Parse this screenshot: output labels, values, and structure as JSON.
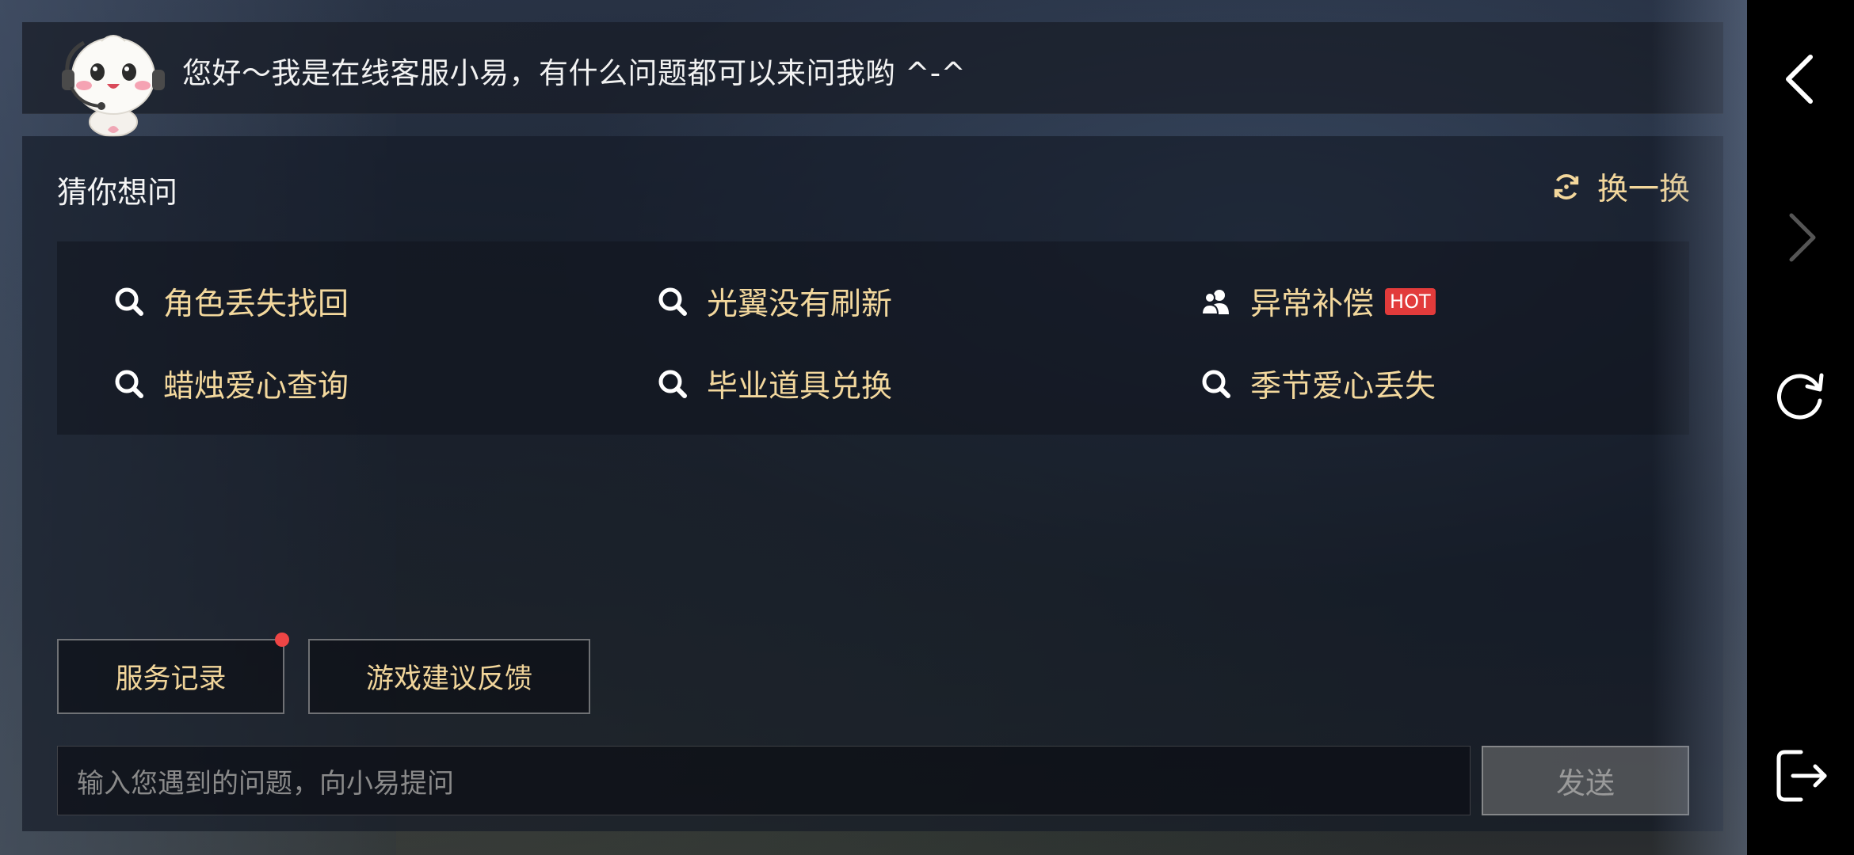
{
  "greeting": {
    "text": "您好～我是在线客服小易，有什么问题都可以来问我哟 ^-^",
    "avatar_icon": "mascot-avatar-with-headset"
  },
  "guess": {
    "title": "猜你想问",
    "refresh_label": "换一换",
    "refresh_icon": "refresh-icon",
    "questions": [
      {
        "label": "角色丢失找回",
        "icon": "search-icon"
      },
      {
        "label": "光翼没有刷新",
        "icon": "search-icon"
      },
      {
        "label": "异常补偿",
        "icon": "users-icon",
        "badge": "HOT"
      },
      {
        "label": "蜡烛爱心查询",
        "icon": "search-icon"
      },
      {
        "label": "毕业道具兑换",
        "icon": "search-icon"
      },
      {
        "label": "季节爱心丢失",
        "icon": "search-icon"
      }
    ]
  },
  "actions": {
    "service_record": "服务记录",
    "feedback": "游戏建议反馈"
  },
  "chat_input": {
    "placeholder": "输入您遇到的问题，向小易提问",
    "send_label": "发送"
  },
  "system_bar": {
    "back_icon": "back-arrow-icon",
    "forward_icon": "forward-arrow-icon",
    "reload_icon": "reload-icon",
    "exit_icon": "exit-icon"
  },
  "colors": {
    "accent_gold": "#f3d89d",
    "hot_badge": "#e23b3b",
    "notification_dot": "#ee4545"
  }
}
